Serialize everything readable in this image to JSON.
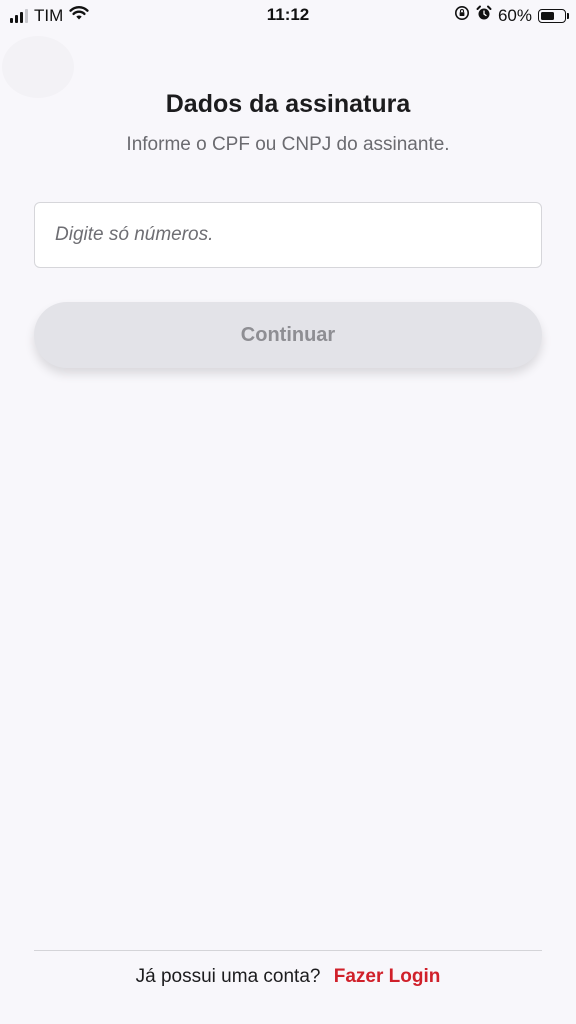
{
  "status_bar": {
    "carrier": "TIM",
    "time": "11:12",
    "battery_text": "60%",
    "battery_level": 0.6,
    "signal_bars_active": 3,
    "signal_bars_total": 4
  },
  "header": {
    "title": "Dados da assinatura",
    "subtitle": "Informe o CPF ou CNPJ do assinante."
  },
  "form": {
    "document_input": {
      "value": "",
      "placeholder": "Digite só números."
    },
    "continue_label": "Continuar"
  },
  "footer": {
    "question": "Já possui uma conta?",
    "login_label": "Fazer Login"
  },
  "colors": {
    "background": "#f8f7fb",
    "accent": "#d0202a",
    "button_disabled_bg": "#e3e3e8",
    "button_disabled_text": "#8e8e93"
  },
  "icons": {
    "signal": "signal-icon",
    "wifi": "wifi-icon",
    "orientation_lock": "orientation-lock-icon",
    "alarm": "alarm-icon",
    "battery": "battery-icon"
  }
}
